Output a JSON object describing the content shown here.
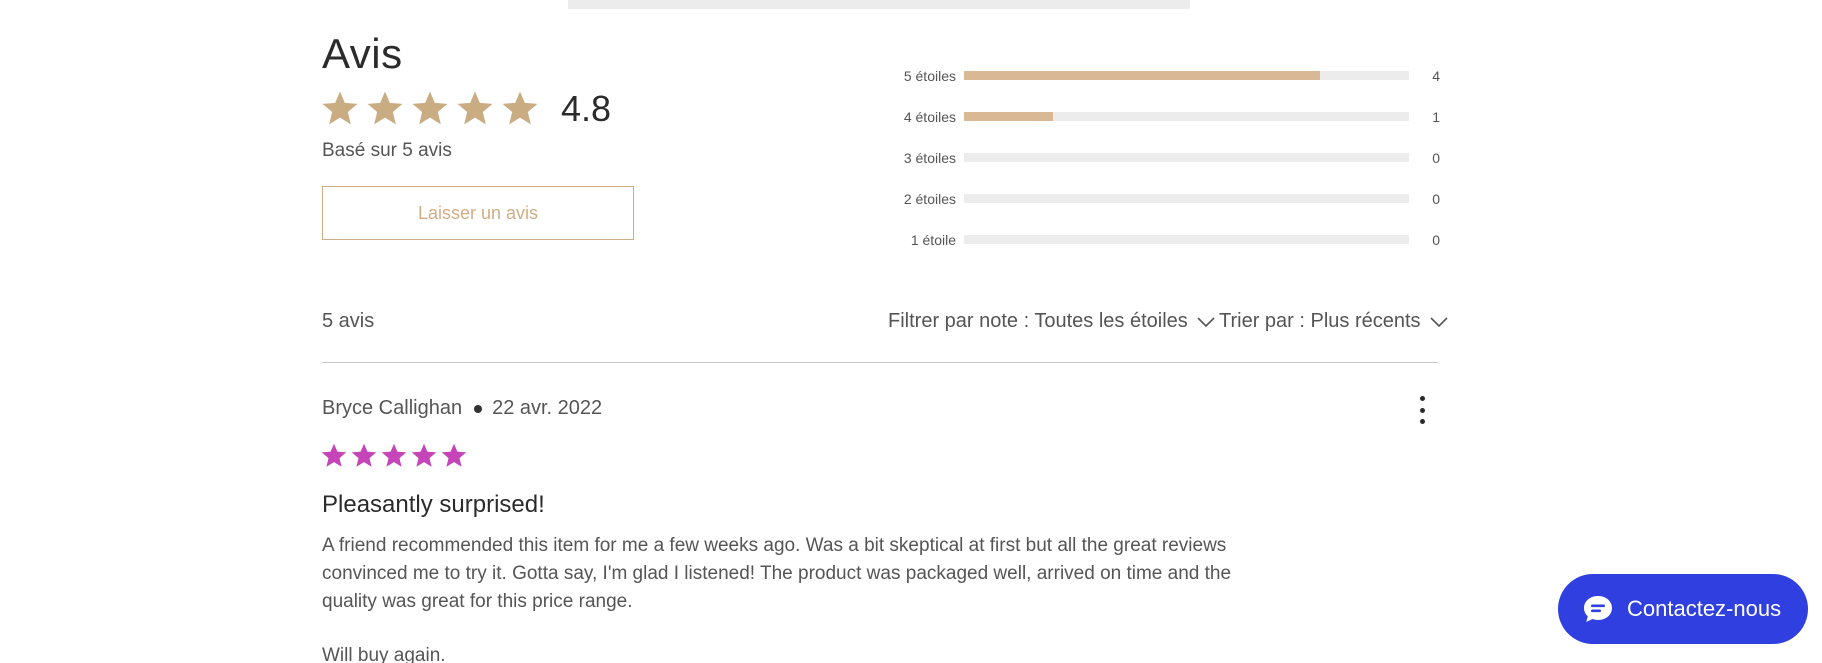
{
  "summary": {
    "title": "Avis",
    "average_rating": "4.8",
    "average_stars": 5,
    "based_on": "Basé sur 5 avis",
    "leave_review_label": "Laisser un avis",
    "star_color": "#c9ac82"
  },
  "histogram": {
    "total": 5,
    "fill_color": "#d9b896",
    "rows": [
      {
        "label": "5 étoiles",
        "count": "4",
        "fraction": 0.8
      },
      {
        "label": "4 étoiles",
        "count": "1",
        "fraction": 0.2
      },
      {
        "label": "3 étoiles",
        "count": "0",
        "fraction": 0
      },
      {
        "label": "2 étoiles",
        "count": "0",
        "fraction": 0
      },
      {
        "label": "1 étoile",
        "count": "0",
        "fraction": 0
      }
    ]
  },
  "toolbar": {
    "review_count": "5 avis",
    "filter_label": "Filtrer par note : Toutes les étoiles",
    "sort_label": "Trier par : Plus récents"
  },
  "reviews": [
    {
      "author": "Bryce Callighan",
      "date": "22 avr. 2022",
      "rating": 5,
      "star_color": "#c544b7",
      "title": "Pleasantly surprised!",
      "body": [
        "A friend recommended this item for me a few weeks ago. Was a bit skeptical at first but all the great reviews convinced me to try it. Gotta say, I'm glad I listened! The product was packaged well, arrived on time and the quality was great for this price range.",
        "Will buy again."
      ]
    }
  ],
  "chat": {
    "label": "Contactez-nous",
    "icon": "chat-bubble-icon",
    "color": "#2f3fe0"
  }
}
